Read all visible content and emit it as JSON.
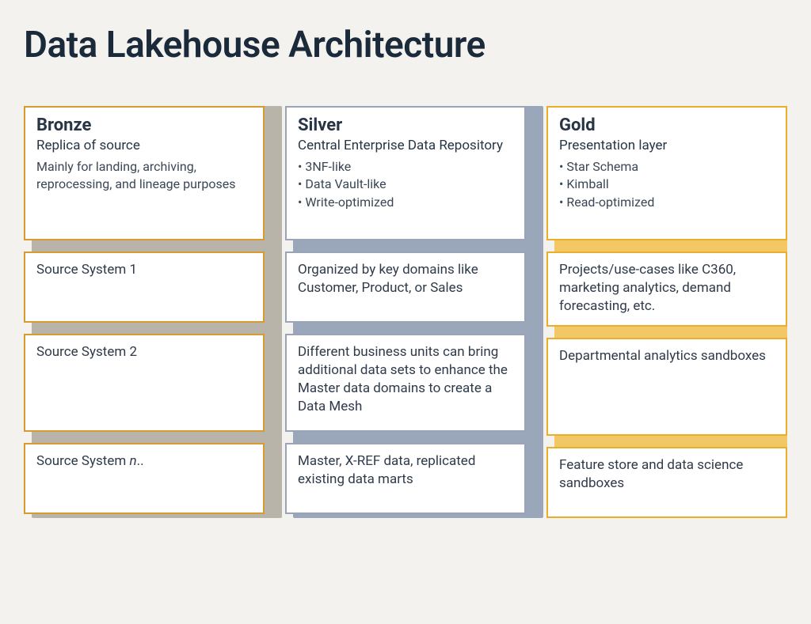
{
  "title": "Data Lakehouse Architecture",
  "columns": {
    "bronze": {
      "name": "Bronze",
      "subtitle": "Replica of source",
      "description": "Mainly for landing, archiving, reprocessing, and lineage purposes",
      "items": [
        "Source System 1",
        "Source System 2",
        "Source System n.."
      ]
    },
    "silver": {
      "name": "Silver",
      "subtitle": "Central Enterprise Data Repository",
      "bullets": [
        "3NF-like",
        "Data Vault-like",
        "Write-optimized"
      ],
      "items": [
        "Organized by key domains like Customer, Product, or Sales",
        "Different business units can bring additional data sets to enhance the Master data domains to create a Data Mesh",
        "Master, X-REF data, replicated existing data marts"
      ]
    },
    "gold": {
      "name": "Gold",
      "subtitle": "Presentation layer",
      "bullets": [
        "Star Schema",
        "Kimball",
        "Read-optimized"
      ],
      "items": [
        "Projects/use-cases like C360, marketing analytics, demand forecasting, etc.",
        "Departmental analytics sandboxes",
        "Feature store and data science sandboxes"
      ]
    }
  },
  "colors": {
    "bronze_border": "#d89b2f",
    "silver_border": "#99a5b7",
    "gold_border": "#eaae2a",
    "bronze_stripe": "#b9b4aa",
    "silver_stripe": "#9aa6ba",
    "gold_stripe": "#f2c766"
  }
}
